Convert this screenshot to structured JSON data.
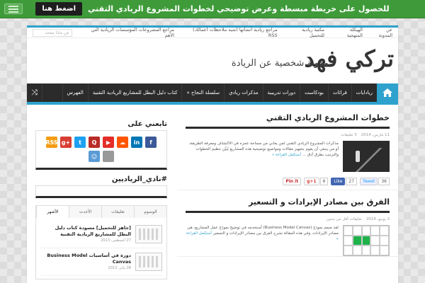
{
  "promo": {
    "text": "للحصول على خريطة مبسطة وعرض توضيحي لخطوات المشروع الريادي التقني",
    "button": "اضغط هنا"
  },
  "topnav": {
    "links": [
      "عن المدونة",
      "الهيكلة المنهجية",
      "مكتبة ريادية للتحميل",
      "مراجع ريادية أنشأتها (شبه ملاحظات أعمالك) RSS",
      "مراجع المشروعات المؤسسات الريادية التي الأهم"
    ],
    "search_placeholder": "عن ماذا تبحث"
  },
  "logo": {
    "title": "تركي فهد",
    "subtitle": "مدونة شخصية عن الريادة"
  },
  "mainnav": {
    "items": [
      "ريادايات",
      "قرائات",
      "بودكاست",
      "دورات تدريبية",
      "مذكرات ريادي",
      "سلسلة النجاح «",
      "كتاب دليل البطل للمشاريع الريادية التقنية",
      "الفهرس"
    ]
  },
  "posts": [
    {
      "title": "خطوات المشروع الريادي التقني",
      "date": "11 مارس، 2014",
      "comments": "3 تعليقات",
      "excerpt": "مذكرات المشروع الريادي التقني لمن يعاني من مساحة عجزه في الاكتشاف ومعرفة الطريقة، أو من ينبغي أن يقوم بتجهيز مقالات ومواضيع توضيحية هذه المشاريع يُبيِّن تنظيم الخطوات والترتيب بطرق أدق ...",
      "read_more": "أستكمل القراءة «",
      "share": {
        "tweet": "Tweet",
        "tweet_count": "36",
        "like": "Like",
        "like_count": "27",
        "gplus": "g+1",
        "gplus_count": "6",
        "pin": "Pin it"
      }
    },
    {
      "title": "الفرق بين مصادر الإيرادات و التسعير",
      "date": "3 يونيو، 2014",
      "comments": "تعليقات أقل من ستين",
      "excerpt": "لقد صمم نموذج (Business Model Canvas) أستخدمه في توضيح نموذج عمل المشاريع، هي مصادر الإيرادات، وفي هذه المقالة نشرح الفرق بين مصادر الإيرادات و التسعير",
      "read_more": "أستكمل القراءة «"
    }
  ],
  "sidebar": {
    "follow_title": "تابعني على",
    "social": [
      {
        "icon": "rss-icon",
        "label": "RSS",
        "color": "#f39c12"
      },
      {
        "icon": "google-plus-icon",
        "label": "g+",
        "color": "#d73d32"
      },
      {
        "icon": "twitter-icon",
        "label": "t",
        "color": "#1da1f2"
      },
      {
        "icon": "quora-icon",
        "label": "Q",
        "color": "#b92b27"
      },
      {
        "icon": "youtube-icon",
        "label": "▶",
        "color": "#e52d27"
      },
      {
        "icon": "soundcloud-icon",
        "label": "☁",
        "color": "#ff5500"
      },
      {
        "icon": "linkedin-icon",
        "label": "in",
        "color": "#0077b5"
      },
      {
        "icon": "facebook-icon",
        "label": "f",
        "color": "#3b5998"
      },
      {
        "icon": "finder-icon",
        "label": "☺",
        "color": "#5a9bd5"
      },
      {
        "icon": "apple-icon",
        "label": "",
        "color": "#999999"
      }
    ],
    "hashtag_title": "#نادي_الرياديين",
    "tabs": [
      "الأشهر",
      "الأحدث",
      "تعليقات",
      "الوسوم"
    ],
    "tab_items": [
      {
        "title": "[جاهز للتحميل] مسودة كتاب دليل البطل للمشاريع الريادية التقنية",
        "date": "27 أغسطس، 2013"
      },
      {
        "title": "دورة في أساسيات Business Model Canvas",
        "date": "28 يناير، 2013"
      }
    ]
  }
}
